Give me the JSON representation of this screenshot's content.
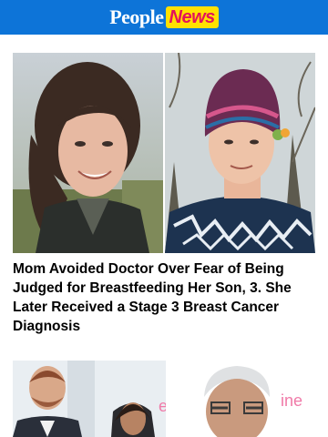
{
  "header": {
    "logo_people": "People",
    "logo_news": "News",
    "colors": {
      "bar": "#0d74d8",
      "news_bg": "#ffe100",
      "news_text": "#e3125b"
    }
  },
  "feed": {
    "stories": [
      {
        "headline": "Mom Avoided Doctor Over Fear of Being Judged for Breastfeeding Her Son, 3. She Later Received a Stage 3 Breast Cancer Diagnosis",
        "image_alt": "Two photos of a woman, before and after chemotherapy"
      },
      {
        "headline": "",
        "image_alt": "Man and woman at an event; older man at a pink backdrop",
        "backdrop_letters_left": "e",
        "backdrop_letters_right": "ine"
      }
    ]
  }
}
